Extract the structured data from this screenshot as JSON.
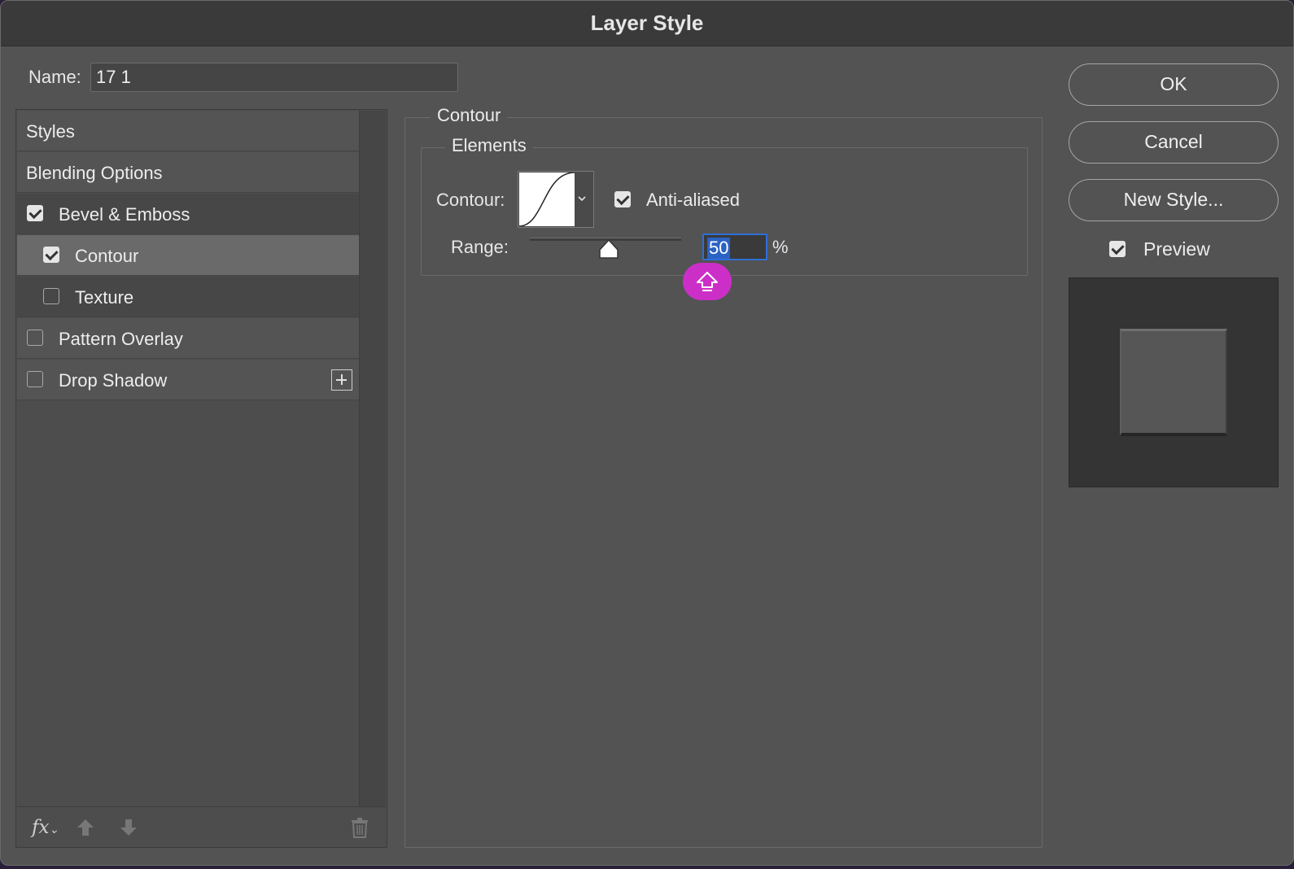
{
  "window": {
    "title": "Layer Style"
  },
  "name_field": {
    "label": "Name:",
    "value": "17 1"
  },
  "style_list": {
    "items": [
      {
        "label": "Styles",
        "checkbox": false,
        "checked": false
      },
      {
        "label": "Blending Options",
        "checkbox": false,
        "checked": false
      },
      {
        "label": "Bevel & Emboss",
        "checkbox": true,
        "checked": true
      },
      {
        "label": "Contour",
        "checkbox": true,
        "checked": true,
        "selected": true
      },
      {
        "label": "Texture",
        "checkbox": true,
        "checked": false
      },
      {
        "label": "Pattern Overlay",
        "checkbox": true,
        "checked": false
      },
      {
        "label": "Drop Shadow",
        "checkbox": true,
        "checked": false
      }
    ],
    "footer_icons": [
      "fx-icon",
      "move-up-icon",
      "move-down-icon",
      "trash-icon"
    ],
    "fx_label": "fx"
  },
  "contour_panel": {
    "section_title": "Contour",
    "group_title": "Elements",
    "contour_label": "Contour:",
    "anti_aliased_label": "Anti-aliased",
    "anti_aliased_checked": true,
    "range_label": "Range:",
    "range_value": "50",
    "range_unit": "%",
    "range_fraction": 0.5
  },
  "buttons": {
    "ok": "OK",
    "cancel": "Cancel",
    "new_style": "New Style..."
  },
  "preview": {
    "label": "Preview",
    "checked": true
  },
  "colors": {
    "dialog_bg": "#535353",
    "selection_blue": "#2b63c4",
    "shift_badge": "#cc2fc8"
  }
}
